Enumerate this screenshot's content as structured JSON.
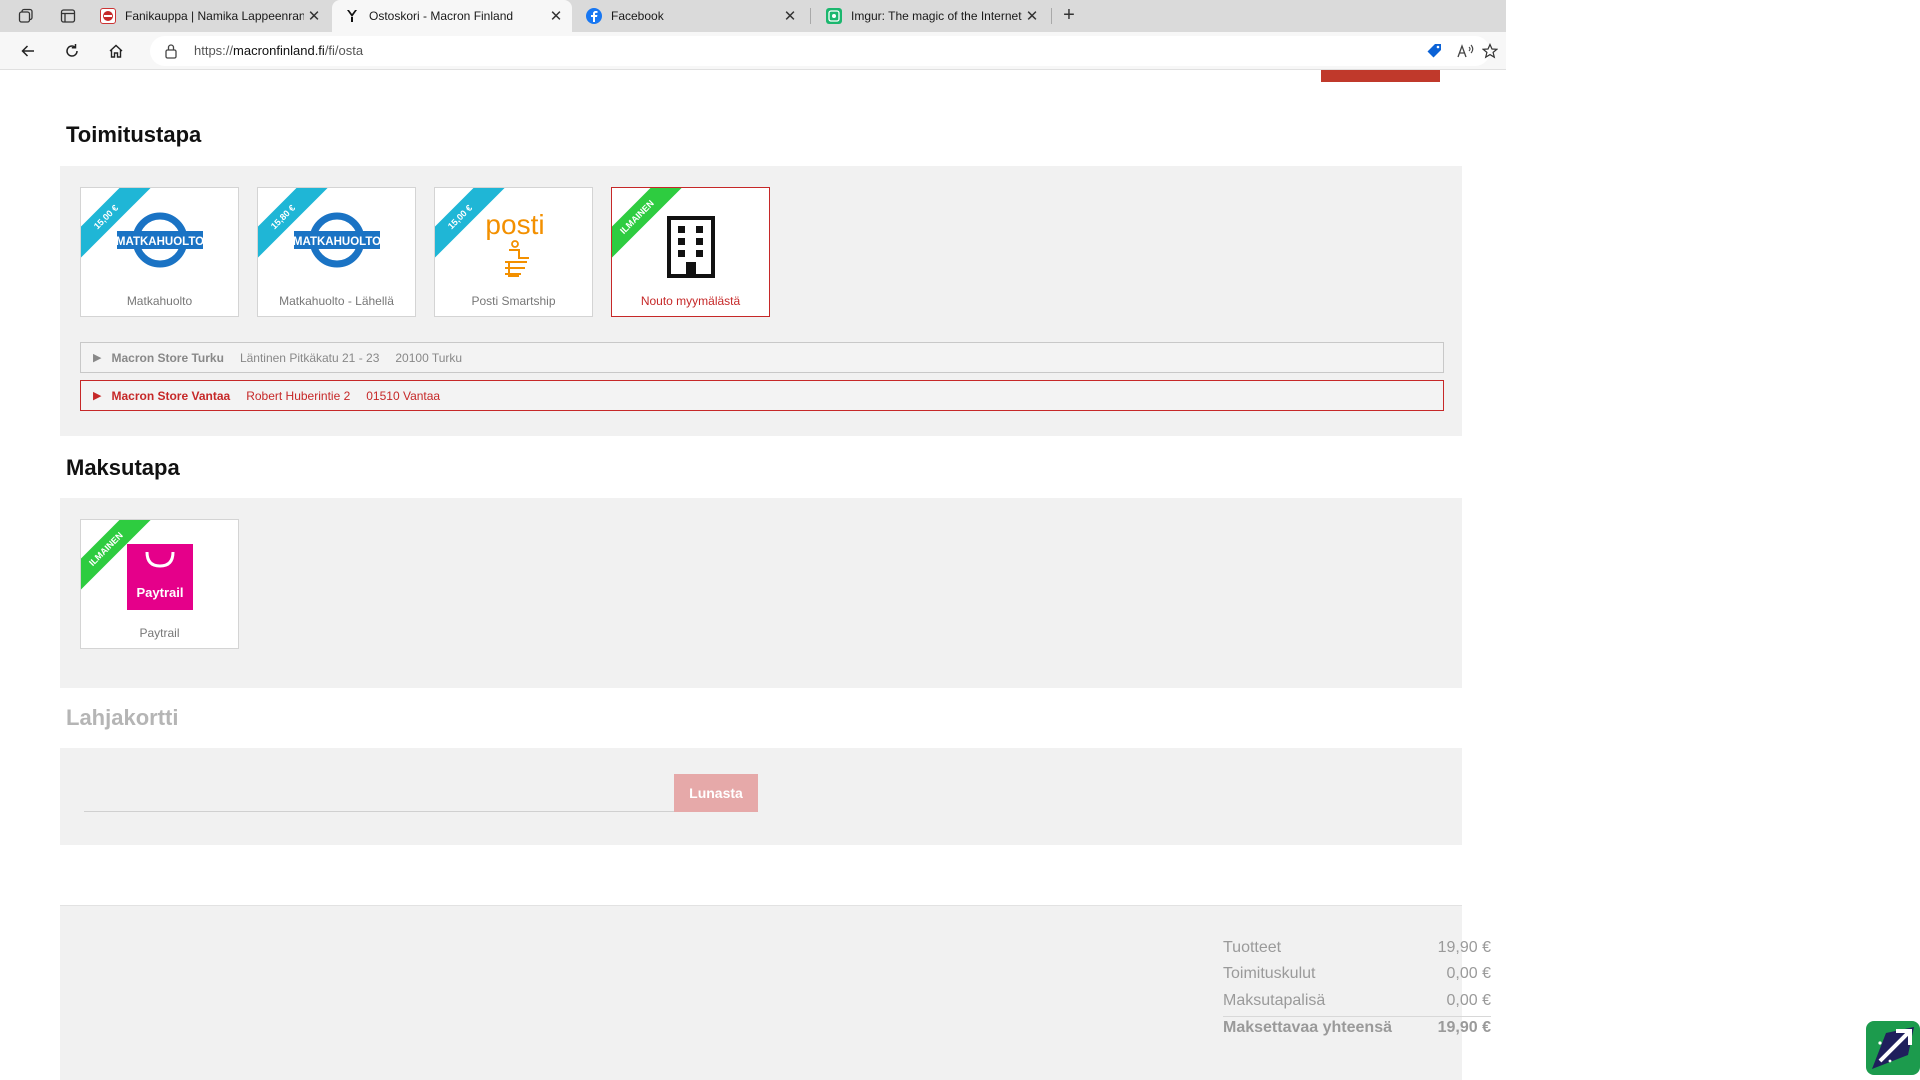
{
  "browser": {
    "tabs": [
      {
        "label": "Fanikauppa | Namika Lappeenranta",
        "icon": "namika-favicon",
        "active": false
      },
      {
        "label": "Ostoskori - Macron Finland",
        "icon": "macron-favicon",
        "active": true
      },
      {
        "label": "Facebook",
        "icon": "facebook-favicon",
        "active": false
      },
      {
        "label": "Imgur: The magic of the Internet",
        "icon": "imgur-favicon",
        "active": false
      }
    ],
    "url_prefix": "https://",
    "url_host": "macronfinland.fi",
    "url_path": "/fi/osta"
  },
  "delivery": {
    "title": "Toimitustapa",
    "options": [
      {
        "label": "Matkahuolto",
        "ribbon": "15,00 €",
        "ribbon_color": "#1fb6d6",
        "logo_text": "MATKAHUOLTO",
        "selected": false
      },
      {
        "label": "Matkahuolto - Lähellä",
        "ribbon": "15,80 €",
        "ribbon_color": "#1fb6d6",
        "logo_text": "MATKAHUOLTO",
        "selected": false
      },
      {
        "label": "Posti Smartship",
        "ribbon": "15,00 €",
        "ribbon_color": "#1fb6d6",
        "logo_text": "posti",
        "selected": false
      },
      {
        "label": "Nouto myymälästä",
        "ribbon": "ILMAINEN",
        "ribbon_color": "#2ecc40",
        "icon": "building-icon",
        "selected": true
      }
    ],
    "stores": [
      {
        "name": "Macron Store Turku",
        "address": "Läntinen Pitkäkatu 21 - 23",
        "city": "20100 Turku",
        "selected": false
      },
      {
        "name": "Macron Store Vantaa",
        "address": "Robert Huberintie 2",
        "city": "01510 Vantaa",
        "selected": true
      }
    ]
  },
  "payment": {
    "title": "Maksutapa",
    "options": [
      {
        "label": "Paytrail",
        "ribbon": "ILMAINEN",
        "ribbon_color": "#2ecc40",
        "logo_text": "Paytrail",
        "selected": false
      }
    ]
  },
  "giftcard": {
    "title": "Lahjakortti",
    "input_value": "",
    "button_label": "Lunasta"
  },
  "summary": {
    "rows": [
      {
        "label": "Tuotteet",
        "value": "19,90 €"
      },
      {
        "label": "Toimituskulut",
        "value": "0,00 €"
      },
      {
        "label": "Maksutapalisä",
        "value": "0,00 €"
      }
    ],
    "total_label": "Maksettavaa yhteensä",
    "total_value": "19,90 €"
  },
  "colors": {
    "accent_red": "#c62828",
    "ribbon_blue": "#1fb6d6",
    "ribbon_green": "#2ecc40",
    "paytrail_pink": "#e5008a",
    "matkahuolto_blue": "#1a73c4",
    "posti_orange": "#f39000"
  }
}
